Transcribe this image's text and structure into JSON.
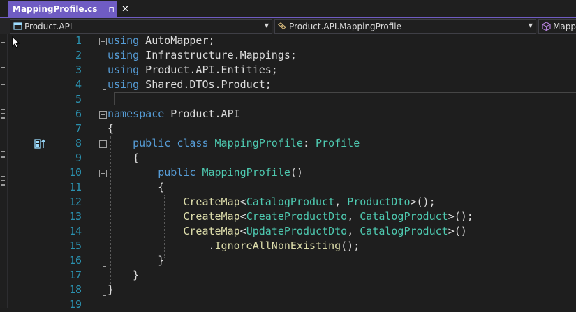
{
  "tab": {
    "title": "MappingProfile.cs",
    "pin": "⊓",
    "close": "✕"
  },
  "nav": {
    "project": "Product.API",
    "type": "Product.API.MappingProfile",
    "member": "Mapp"
  },
  "lines": [
    {
      "n": "1",
      "tokens": [
        [
          "kw",
          "using"
        ],
        [
          "df",
          " AutoMapper;"
        ]
      ]
    },
    {
      "n": "2",
      "tokens": [
        [
          "kw",
          "using"
        ],
        [
          "df",
          " Infrastructure.Mappings;"
        ]
      ]
    },
    {
      "n": "3",
      "tokens": [
        [
          "kw",
          "using"
        ],
        [
          "df",
          " Product.API.Entities;"
        ]
      ]
    },
    {
      "n": "4",
      "tokens": [
        [
          "kw",
          "using"
        ],
        [
          "df",
          " Shared.DTOs.Product;"
        ]
      ]
    },
    {
      "n": "5",
      "tokens": []
    },
    {
      "n": "6",
      "tokens": [
        [
          "kw",
          "namespace"
        ],
        [
          "df",
          " Product.API"
        ]
      ]
    },
    {
      "n": "7",
      "tokens": [
        [
          "df",
          "{"
        ]
      ]
    },
    {
      "n": "8",
      "tokens": [
        [
          "df",
          "    "
        ],
        [
          "kw",
          "public"
        ],
        [
          "df",
          " "
        ],
        [
          "kw",
          "class"
        ],
        [
          "df",
          " "
        ],
        [
          "ty",
          "MappingProfile"
        ],
        [
          "df",
          ": "
        ],
        [
          "ty",
          "Profile"
        ]
      ]
    },
    {
      "n": "9",
      "tokens": [
        [
          "df",
          "    {"
        ]
      ]
    },
    {
      "n": "10",
      "tokens": [
        [
          "df",
          "        "
        ],
        [
          "kw",
          "public"
        ],
        [
          "df",
          " "
        ],
        [
          "ty",
          "MappingProfile"
        ],
        [
          "df",
          "()"
        ]
      ]
    },
    {
      "n": "11",
      "tokens": [
        [
          "df",
          "        {"
        ]
      ]
    },
    {
      "n": "12",
      "tokens": [
        [
          "df",
          "            "
        ],
        [
          "fn",
          "CreateMap"
        ],
        [
          "df",
          "<"
        ],
        [
          "ty",
          "CatalogProduct"
        ],
        [
          "df",
          ", "
        ],
        [
          "ty",
          "ProductDto"
        ],
        [
          "df",
          ">();"
        ]
      ]
    },
    {
      "n": "13",
      "tokens": [
        [
          "df",
          "            "
        ],
        [
          "fn",
          "CreateMap"
        ],
        [
          "df",
          "<"
        ],
        [
          "ty",
          "CreateProductDto"
        ],
        [
          "df",
          ", "
        ],
        [
          "ty",
          "CatalogProduct"
        ],
        [
          "df",
          ">();"
        ]
      ]
    },
    {
      "n": "14",
      "tokens": [
        [
          "df",
          "            "
        ],
        [
          "fn",
          "CreateMap"
        ],
        [
          "df",
          "<"
        ],
        [
          "ty",
          "UpdateProductDto"
        ],
        [
          "df",
          ", "
        ],
        [
          "ty",
          "CatalogProduct"
        ],
        [
          "df",
          ">()"
        ]
      ]
    },
    {
      "n": "15",
      "tokens": [
        [
          "df",
          "                ."
        ],
        [
          "fn",
          "IgnoreAllNonExisting"
        ],
        [
          "df",
          "();"
        ]
      ]
    },
    {
      "n": "16",
      "tokens": [
        [
          "df",
          "        }"
        ]
      ]
    },
    {
      "n": "17",
      "tokens": [
        [
          "df",
          "    }"
        ]
      ]
    },
    {
      "n": "18",
      "tokens": [
        [
          "df",
          "}"
        ]
      ]
    },
    {
      "n": "19",
      "tokens": []
    }
  ],
  "colors": {
    "accent": "#6f5cc3",
    "keyword": "#569cd6",
    "type": "#4ec9b0",
    "method": "#dcdcaa",
    "line_number": "#2b91af"
  }
}
